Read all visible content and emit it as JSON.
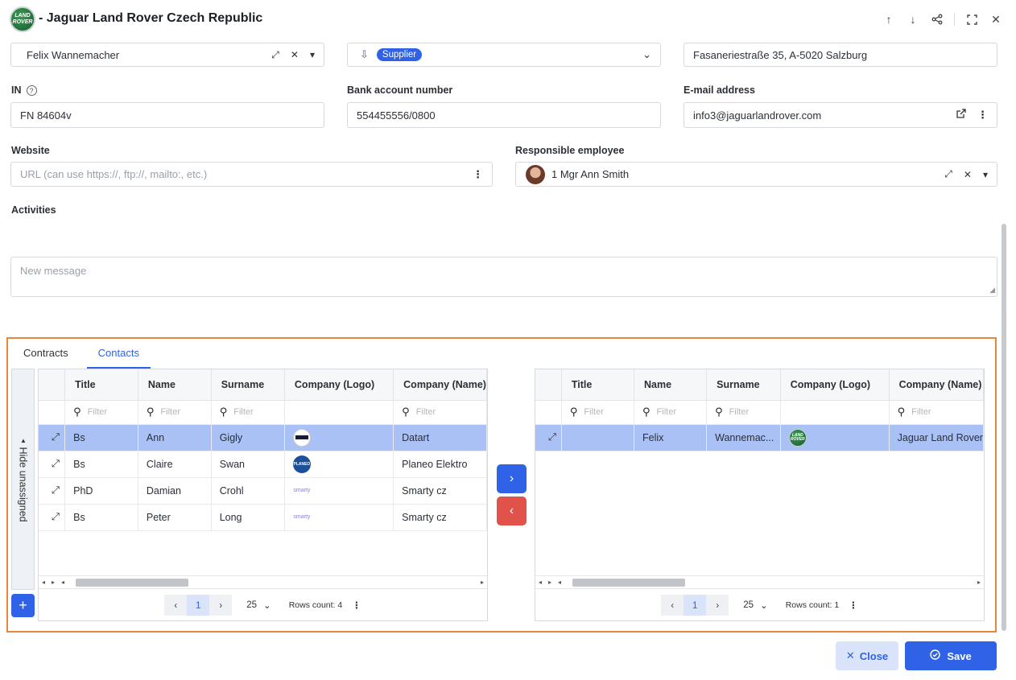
{
  "window": {
    "logo_line1": "LAND",
    "logo_line2": "ROVER",
    "title": "- Jaguar Land Rover Czech Republic",
    "actions": [
      "arrow-up-icon",
      "arrow-down-icon",
      "share-icon",
      "fullscreen-icon",
      "close-icon"
    ]
  },
  "form": {
    "contact_person": {
      "value": "Felix  Wannemacher"
    },
    "type": {
      "badge": "Supplier"
    },
    "address": {
      "value": "Fasaneriestraße 35, A-5020 Salzburg"
    },
    "in": {
      "label": "IN",
      "value": "FN 84604v"
    },
    "bank": {
      "label": "Bank account number",
      "value": "554455556/0800"
    },
    "email": {
      "label": "E-mail address",
      "value": "info3@jaguarlandrover.com"
    },
    "website": {
      "label": "Website",
      "placeholder": "URL (can use https://, ftp://, mailto:, etc.)"
    },
    "responsible": {
      "label": "Responsible employee",
      "value": "1  Mgr  Ann  Smith"
    },
    "activities": {
      "label": "Activities",
      "placeholder": "New message"
    }
  },
  "tabs": [
    {
      "label": "Contracts",
      "active": false
    },
    {
      "label": "Contacts",
      "active": true
    }
  ],
  "side": {
    "hide_label": "Hide unassigned",
    "add_label": "+"
  },
  "columns": [
    "Title",
    "Name",
    "Surname",
    "Company (Logo)",
    "Company (Name)"
  ],
  "filter_placeholder": "Filter",
  "left_grid": {
    "rows": [
      {
        "title": "Bs",
        "name": "Ann",
        "surname": "Gigly",
        "logo": "datart",
        "company": "Datart",
        "selected": true
      },
      {
        "title": "Bs",
        "name": "Claire",
        "surname": "Swan",
        "logo": "planeo",
        "company": "Planeo Elektro",
        "selected": false
      },
      {
        "title": "PhD",
        "name": "Damian",
        "surname": "Crohl",
        "logo": "smarty",
        "company": "Smarty cz",
        "selected": false
      },
      {
        "title": "Bs",
        "name": "Peter",
        "surname": "Long",
        "logo": "smarty",
        "company": "Smarty cz",
        "selected": false
      }
    ],
    "pager": {
      "page": "1",
      "page_size": "25",
      "rows_count": "Rows count: 4"
    }
  },
  "right_grid": {
    "rows": [
      {
        "title": "",
        "name": "Felix",
        "surname": "Wannemac...",
        "logo": "jlr",
        "company": "Jaguar Land Rover",
        "selected": true
      }
    ],
    "pager": {
      "page": "1",
      "page_size": "25",
      "rows_count": "Rows count: 1"
    }
  },
  "logos": {
    "planeo": "PLANEO",
    "smarty": "smarty",
    "jlr_line1": "LAND",
    "jlr_line2": "ROVER"
  },
  "buttons": {
    "close": "Close",
    "save": "Save"
  },
  "colors": {
    "accent": "#2f62e6",
    "danger": "#e0524a",
    "highlight": "#e8873a",
    "selected_row": "#a9c1f4"
  }
}
